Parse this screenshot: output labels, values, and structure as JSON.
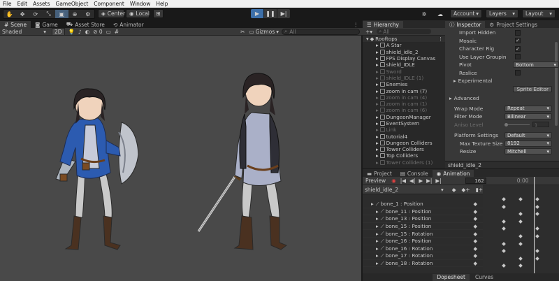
{
  "menu": [
    "File",
    "Edit",
    "Assets",
    "GameObject",
    "Component",
    "Window",
    "Help"
  ],
  "toolbar": {
    "tools": [
      "hand-tool",
      "move-tool",
      "rotate-tool",
      "scale-tool",
      "rect-tool",
      "transform-tool",
      "custom-tool"
    ],
    "pivot_label": "Center",
    "space_label": "Local",
    "account_label": "Account",
    "layers_label": "Layers",
    "layout_label": "Layout"
  },
  "scene": {
    "tabs": [
      "Scene",
      "Game",
      "Asset Store",
      "Animator"
    ],
    "shading_mode": "Shaded",
    "mode_2d": "2D",
    "gizmos_label": "Gizmos",
    "search_placeholder": "All"
  },
  "hierarchy": {
    "title": "Hierarchy",
    "search_placeholder": "All",
    "root": "Rooftops",
    "items": [
      {
        "label": "A Star",
        "dim": false
      },
      {
        "label": "shield_idle_2",
        "dim": false
      },
      {
        "label": "FPS Display Canvas",
        "dim": false
      },
      {
        "label": "shield_IDLE",
        "dim": false
      },
      {
        "label": "Sword",
        "dim": true
      },
      {
        "label": "shield_IDLE (1)",
        "dim": true
      },
      {
        "label": "Enemies",
        "dim": false
      },
      {
        "label": "zoom in cam (7)",
        "dim": false
      },
      {
        "label": "zoom in cam (4)",
        "dim": true
      },
      {
        "label": "zoom in cam (1)",
        "dim": true
      },
      {
        "label": "zoom in cam (6)",
        "dim": true
      },
      {
        "label": "DungeonManager",
        "dim": false
      },
      {
        "label": "EventSystem",
        "dim": false
      },
      {
        "label": "Link",
        "dim": true
      },
      {
        "label": "tutorial4",
        "dim": false
      },
      {
        "label": "Dungeon Colliders",
        "dim": false
      },
      {
        "label": "Tower Colliders",
        "dim": false
      },
      {
        "label": "Top Colliders",
        "dim": false
      },
      {
        "label": "Tower Colliders (1)",
        "dim": true
      }
    ]
  },
  "inspector": {
    "tabs": [
      "Inspector",
      "Project Settings"
    ],
    "rows": [
      {
        "label": "Import Hidden",
        "checked": false
      },
      {
        "label": "Mosaic",
        "checked": true
      },
      {
        "label": "Character Rig",
        "checked": true
      },
      {
        "label": "Use Layer Groupin",
        "checked": false
      }
    ],
    "pivot_label": "Pivot",
    "pivot_value": "Bottom",
    "reslice_label": "Reslice",
    "experimental_label": "Experimental",
    "sprite_editor_label": "Sprite Editor",
    "advanced_label": "Advanced",
    "wrap_mode_label": "Wrap Mode",
    "wrap_mode_value": "Repeat",
    "filter_mode_label": "Filter Mode",
    "filter_mode_value": "Bilinear",
    "aniso_label": "Aniso Level",
    "aniso_value": "1",
    "platform_label": "Platform Settings",
    "platform_value": "Default",
    "max_texture_label": "Max Texture Size",
    "max_texture_value": "8192",
    "resize_label": "Resize",
    "resize_value": "Mitchell",
    "footer_asset": "shield_idle_2"
  },
  "bottom": {
    "tabs": [
      "Project",
      "Console",
      "Animation"
    ],
    "preview_label": "Preview",
    "frame_value": "162",
    "timeline_start": "0:00",
    "clip_name": "shield_idle_2",
    "properties": [
      {
        "label": "bone_1 : Position",
        "indent": 0
      },
      {
        "label": "bone_11 : Position",
        "indent": 1
      },
      {
        "label": "bone_13 : Position",
        "indent": 1
      },
      {
        "label": "bone_15 : Position",
        "indent": 1
      },
      {
        "label": "bone_15 : Rotation",
        "indent": 1
      },
      {
        "label": "bone_16 : Position",
        "indent": 1
      },
      {
        "label": "bone_16 : Rotation",
        "indent": 1
      },
      {
        "label": "bone_17 : Rotation",
        "indent": 1
      },
      {
        "label": "bone_18 : Rotation",
        "indent": 1
      }
    ],
    "footer_tabs": [
      "Dopesheet",
      "Curves"
    ]
  }
}
